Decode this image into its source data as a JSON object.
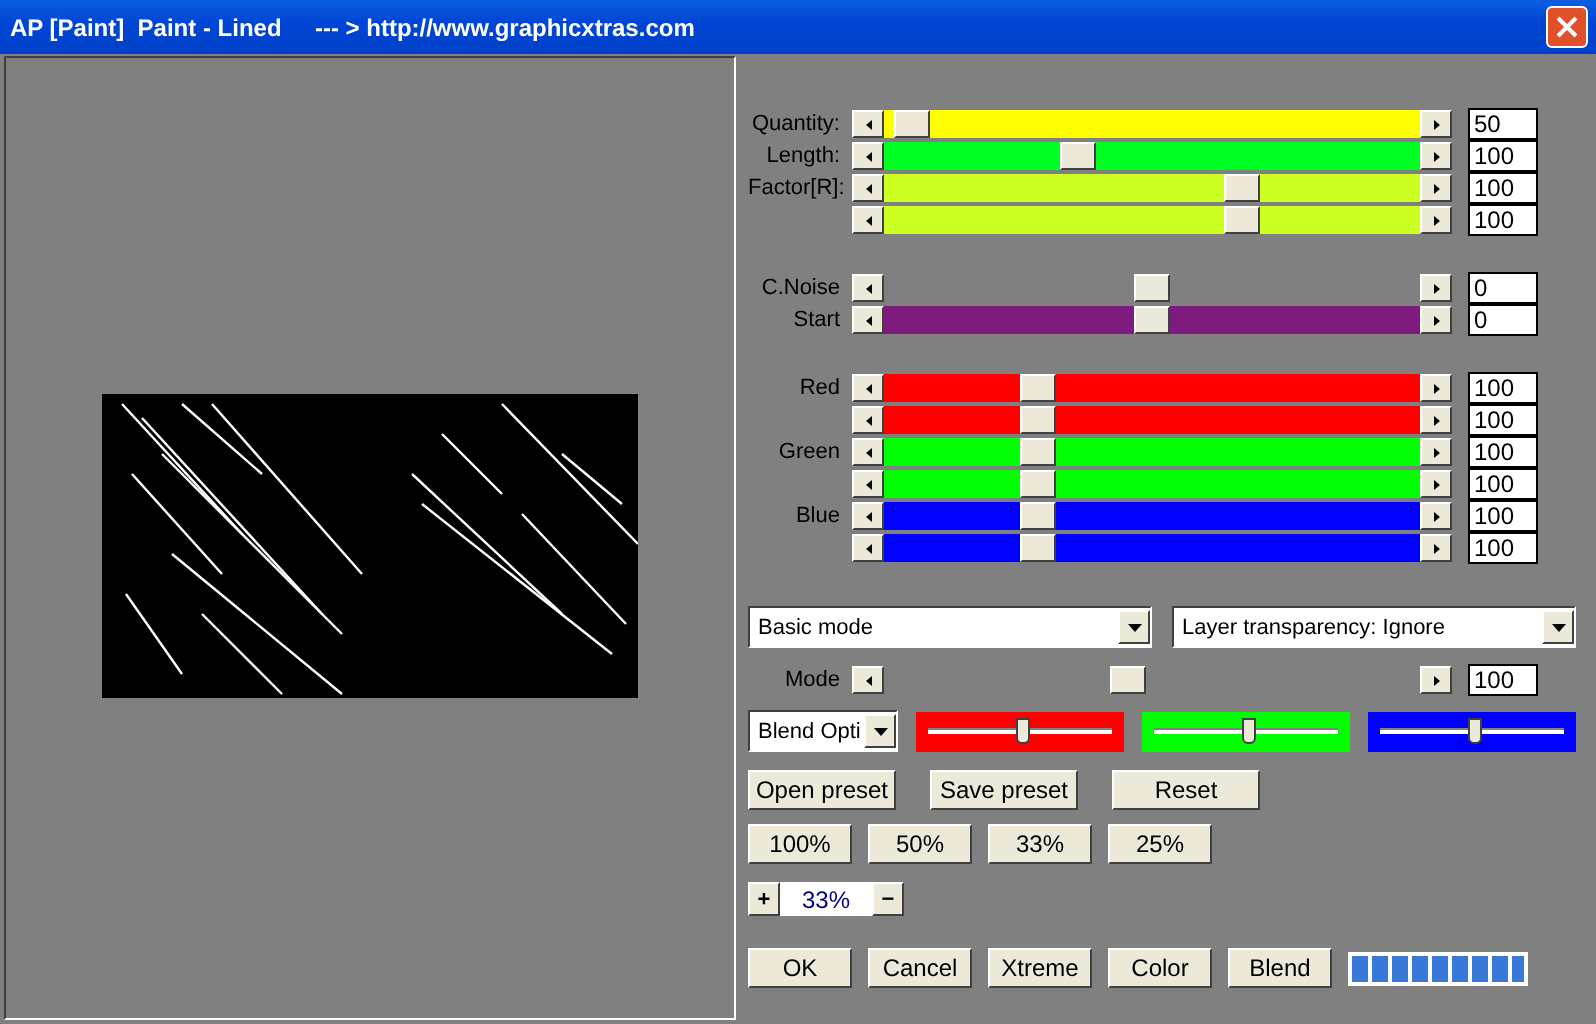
{
  "window": {
    "title": "AP [Paint]  Paint - Lined     --- > http://www.graphicxtras.com"
  },
  "preview": {
    "kind": "picture"
  },
  "slider_groups": [
    [
      {
        "label": "Quantity:",
        "level": 0.02,
        "color": "#ffff00",
        "value": "50"
      },
      {
        "label": "Length:",
        "level": 0.35,
        "color": "#00ff22",
        "value": "100"
      },
      {
        "label": "Factor[R]:",
        "level": 0.68,
        "color": "#ccff22",
        "value": "100"
      },
      {
        "level": 0.68,
        "color": "#ccff22",
        "value": "100"
      }
    ],
    [
      {
        "label": "C.Noise",
        "level": 0.5,
        "value": "0"
      },
      {
        "label": "Start",
        "level": 0.5,
        "color": "#7f1a7f",
        "value": "0"
      }
    ],
    [
      {
        "label": "Red",
        "level": 0.27,
        "color": "#ff0000",
        "value": "100"
      },
      {
        "level": 0.27,
        "color": "#ff0000",
        "value": "100"
      },
      {
        "label": "Green",
        "level": 0.27,
        "color": "#00ff00",
        "value": "100"
      },
      {
        "level": 0.27,
        "color": "#00ff00",
        "value": "100"
      },
      {
        "label": "Blue",
        "level": 0.27,
        "color": "#0000ff",
        "value": "100"
      },
      {
        "level": 0.27,
        "color": "#0000ff",
        "value": "100"
      }
    ]
  ],
  "dropdowns": [
    "Basic mode",
    "Layer transparency: Ignore"
  ],
  "mode_slider": {
    "label": "Mode",
    "level": 0.45,
    "value": "100"
  },
  "blend_dropdown": "Blend Opti",
  "blend_sliders": [
    {
      "color": "#ff0000",
      "level": 0.52
    },
    {
      "color": "#00ff00",
      "level": 0.52
    },
    {
      "color": "#0000ff",
      "level": 0.52
    }
  ],
  "preset_buttons": [
    "Open preset",
    "Save preset",
    "Reset"
  ],
  "zoom_buttons": [
    "100%",
    "50%",
    "33%",
    "25%"
  ],
  "zoom": {
    "plus": "+",
    "value": "33%",
    "minus": "−"
  },
  "action_buttons": [
    "OK",
    "Cancel",
    "Xtreme",
    "Color",
    "Blend"
  ],
  "progress": {
    "level": 1
  }
}
